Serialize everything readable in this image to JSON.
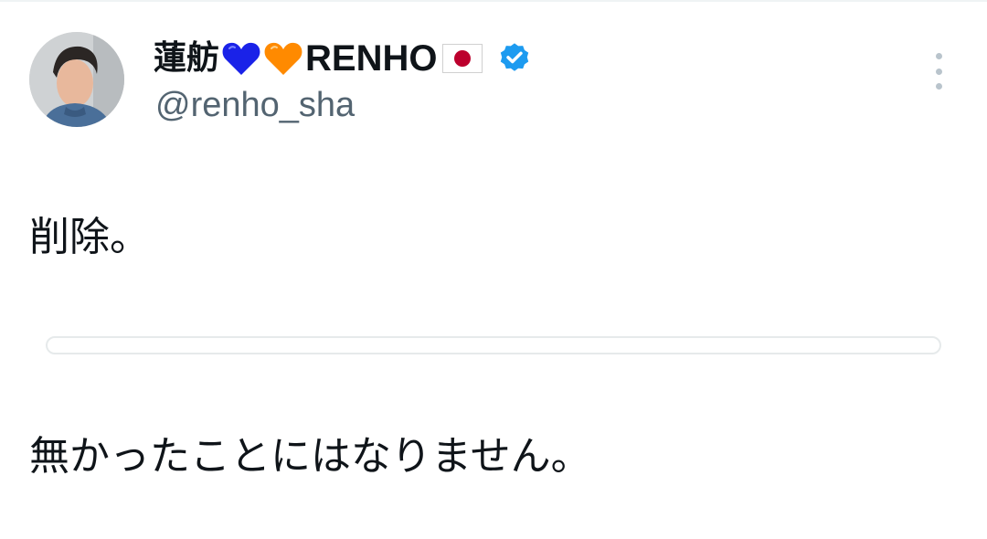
{
  "tweet": {
    "author": {
      "name_kanji": "蓮舫",
      "name_latin": "RENHO",
      "handle": "@renho_sha",
      "hearts": [
        "blue-heart-icon",
        "orange-heart-icon"
      ],
      "flag": "japan-flag-icon",
      "verified_icon": "verified-badge-icon"
    },
    "text_lines": [
      "削除。",
      "",
      "無かったことにはなりません。"
    ],
    "more_icon": "more-options-icon"
  },
  "colors": {
    "heart_blue": "#1a22e8",
    "heart_orange": "#ff8a00",
    "verified_blue": "#1d9bf0",
    "handle_gray": "#536471"
  }
}
